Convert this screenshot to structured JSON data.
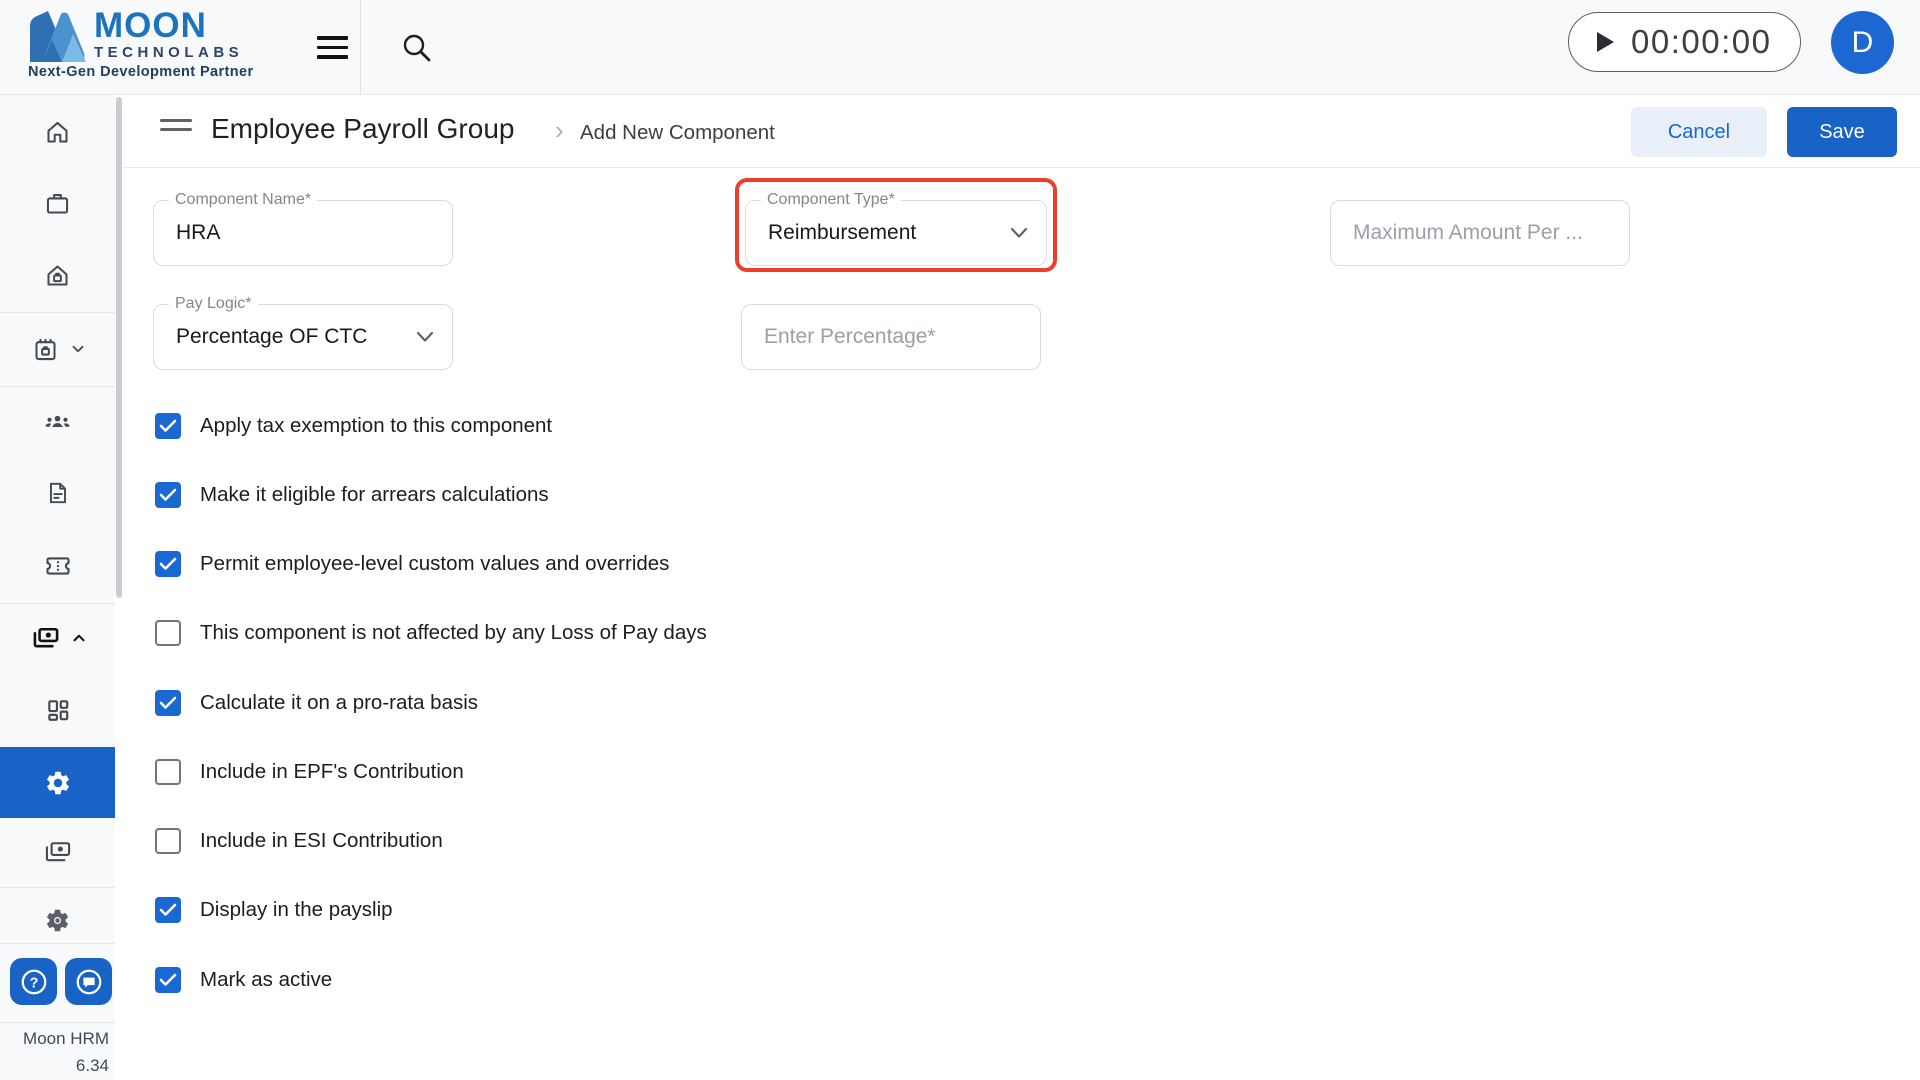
{
  "topbar": {
    "logo": {
      "title": "MOON",
      "subtitle": "TECHNOLABS",
      "tagline": "Next-Gen Development Partner"
    },
    "menu_icon": "hamburger-menu-icon",
    "search_icon": "search-icon",
    "timer": {
      "value": "00:00:00",
      "play_icon": "play-icon"
    },
    "avatar_initial": "D"
  },
  "header": {
    "title": "Employee Payroll Group",
    "breadcrumb_separator": "›",
    "breadcrumb_current": "Add New Component",
    "cancel_label": "Cancel",
    "save_label": "Save"
  },
  "form": {
    "fields": {
      "component_name": {
        "label": "Component Name*",
        "value": "HRA"
      },
      "component_type": {
        "label": "Component Type*",
        "value": "Reimbursement",
        "highlighted": true,
        "highlight_color": "#ee3d2c"
      },
      "max_amount": {
        "placeholder": "Maximum Amount Per ..."
      },
      "pay_logic": {
        "label": "Pay Logic*",
        "value": "Percentage OF CTC"
      },
      "percentage": {
        "placeholder": "Enter Percentage*"
      }
    },
    "checkboxes": [
      {
        "label": "Apply tax exemption to this component",
        "checked": true
      },
      {
        "label": "Make it eligible for arrears calculations",
        "checked": true
      },
      {
        "label": "Permit employee-level custom values and overrides",
        "checked": true
      },
      {
        "label": "This component is not affected by any Loss of Pay days",
        "checked": false
      },
      {
        "label": "Calculate it on a pro-rata basis",
        "checked": true
      },
      {
        "label": "Include in EPF's Contribution",
        "checked": false
      },
      {
        "label": "Include in ESI Contribution",
        "checked": false
      },
      {
        "label": "Display in the payslip",
        "checked": true
      },
      {
        "label": "Mark as active",
        "checked": true
      }
    ]
  },
  "sidebar": {
    "items": [
      {
        "icon": "home-icon"
      },
      {
        "icon": "briefcase-icon"
      },
      {
        "icon": "home-work-icon"
      },
      {
        "icon": "calendar-icon",
        "expandable": true,
        "state": "collapsed"
      },
      {
        "icon": "groups-icon"
      },
      {
        "icon": "document-icon"
      },
      {
        "icon": "ticket-icon"
      },
      {
        "icon": "payments-icon",
        "expandable": true,
        "state": "expanded"
      },
      {
        "icon": "dashboard-icon"
      },
      {
        "icon": "settings-icon",
        "active": true
      },
      {
        "icon": "payments-icon"
      },
      {
        "icon": "settings-icon"
      }
    ],
    "bottom_buttons": [
      {
        "icon": "help-icon"
      },
      {
        "icon": "chat-icon"
      }
    ],
    "footer": {
      "app_name": "Moon HRM",
      "version": "6.34"
    }
  },
  "colors": {
    "primary_blue": "#1a63c6",
    "checkbox_blue": "#1a68d4",
    "highlight_red": "#ee3d2c",
    "topbar_bg": "#f8f9fb",
    "cancel_bg": "#e9eff9"
  }
}
